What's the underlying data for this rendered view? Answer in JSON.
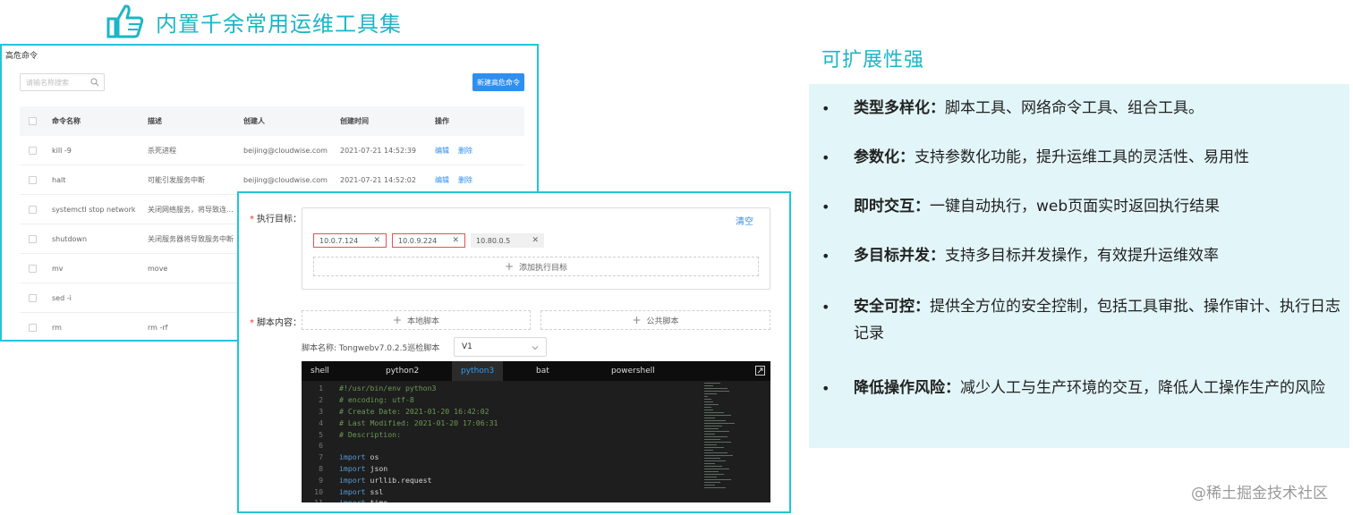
{
  "header": {
    "title": "内置千余常用运维工具集",
    "icon": "thumbs-up-icon",
    "accent_color": "#1bb6c7"
  },
  "danger_panel": {
    "title": "高危命令",
    "search_placeholder": "请输名称搜索",
    "new_button": "新建高危命令",
    "columns": [
      "命令名称",
      "描述",
      "创建人",
      "创建时间",
      "操作"
    ],
    "rows": [
      {
        "name": "kill -9",
        "desc": "杀死进程",
        "creator": "beijing@cloudwise.com",
        "time": "2021-07-21 14:52:39",
        "edit": "编辑",
        "delete": "删除"
      },
      {
        "name": "halt",
        "desc": "可能引发服务中断",
        "creator": "beijing@cloudwise.com",
        "time": "2021-07-21 14:52:02",
        "edit": "编辑",
        "delete": "删除"
      },
      {
        "name": "systemctl stop network",
        "desc": "关闭网络服务，将导致连...",
        "creator": "",
        "time": "",
        "edit": "",
        "delete": ""
      },
      {
        "name": "shutdown",
        "desc": "关闭服务器将导致服务中断",
        "creator": "",
        "time": "",
        "edit": "",
        "delete": ""
      },
      {
        "name": "mv",
        "desc": "move",
        "creator": "",
        "time": "",
        "edit": "",
        "delete": ""
      },
      {
        "name": "sed -i",
        "desc": "",
        "creator": "",
        "time": "",
        "edit": "",
        "delete": ""
      },
      {
        "name": "rm",
        "desc": "rm -rf",
        "creator": "",
        "time": "",
        "edit": "",
        "delete": ""
      }
    ]
  },
  "exec_panel": {
    "target_label": "执行目标：",
    "clear": "清空",
    "targets": [
      {
        "ip": "10.0.7.124",
        "state": "error"
      },
      {
        "ip": "10.0.9.224",
        "state": "error"
      },
      {
        "ip": "10.80.0.5",
        "state": "normal"
      }
    ],
    "add_target": "添加执行目标",
    "script_label": "脚本内容：",
    "local_script": "本地脚本",
    "public_script": "公共脚本",
    "script_name": "脚本名称: Tongwebv7.0.2.5巡检脚本",
    "version": "V1",
    "editor_tabs": [
      "shell",
      "python2",
      "python3",
      "bat",
      "powershell"
    ],
    "active_tab": "python3",
    "code_lines": [
      {
        "no": "1",
        "kind": "cm",
        "text": "#!/usr/bin/env python3"
      },
      {
        "no": "2",
        "kind": "cm",
        "text": "# encoding: utf-8"
      },
      {
        "no": "3",
        "kind": "cm",
        "text": "# Create Date: 2021-01-20 16:42:02"
      },
      {
        "no": "4",
        "kind": "cm",
        "text": "# Last Modified: 2021-01-20 17:06:31"
      },
      {
        "no": "5",
        "kind": "cm",
        "text": "# Description:"
      },
      {
        "no": "6",
        "kind": "tx",
        "text": ""
      },
      {
        "no": "7",
        "kind": "import",
        "text": "os"
      },
      {
        "no": "8",
        "kind": "import",
        "text": "json"
      },
      {
        "no": "9",
        "kind": "import",
        "text": "urllib.request"
      },
      {
        "no": "10",
        "kind": "import",
        "text": "ssl"
      },
      {
        "no": "11",
        "kind": "import",
        "text": "time"
      }
    ],
    "import_keyword": "import"
  },
  "features": {
    "title": "可扩展性强",
    "items": [
      {
        "bold": "类型多样化：",
        "text": "脚本工具、网络命令工具、组合工具。"
      },
      {
        "bold": "参数化：",
        "text": "支持参数化功能，提升运维工具的灵活性、易用性"
      },
      {
        "bold": "即时交互：",
        "text": "一键自动执行，web页面实时返回执行结果"
      },
      {
        "bold": "多目标并发：",
        "text": "支持多目标并发操作，有效提升运维效率"
      },
      {
        "bold": "安全可控：",
        "text": "提供全方位的安全控制，包括工具审批、操作审计、执行日志记录"
      },
      {
        "bold": "降低操作风险：",
        "text": "减少人工与生产环境的交互，降低人工操作生产的风险"
      }
    ]
  },
  "watermark": "@稀土掘金技术社区"
}
